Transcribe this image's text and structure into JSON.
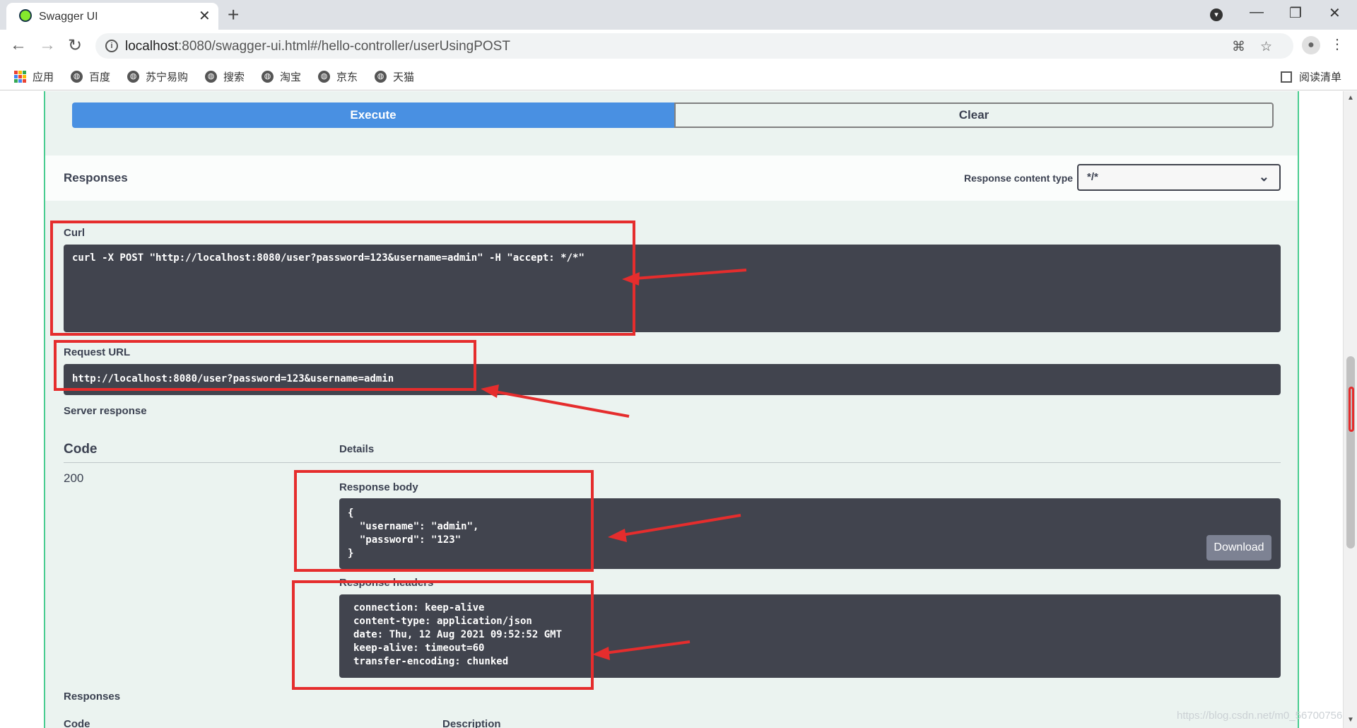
{
  "browser": {
    "tab_title": "Swagger UI",
    "tab_close": "✕",
    "new_tab": "+",
    "url_host": "localhost",
    "url_rest": ":8080/swagger-ui.html#/hello-controller/userUsingPOST",
    "window_controls": {
      "minimize": "—",
      "maximize": "❐",
      "close": "✕"
    }
  },
  "bookmarks": {
    "apps_label": "应用",
    "items": [
      "百度",
      "苏宁易购",
      "搜索",
      "淘宝",
      "京东",
      "天猫"
    ],
    "reading_list": "阅读清单"
  },
  "swagger": {
    "execute_label": "Execute",
    "clear_label": "Clear",
    "responses_title": "Responses",
    "response_content_type_label": "Response content type",
    "response_content_type_value": "*/*",
    "curl_label": "Curl",
    "curl_command": "curl -X POST \"http://localhost:8080/user?password=123&username=admin\" -H \"accept: */*\"",
    "request_url_label": "Request URL",
    "request_url": "http://localhost:8080/user?password=123&username=admin",
    "server_response_label": "Server response",
    "table_code_header": "Code",
    "table_details_header": "Details",
    "status_code": "200",
    "response_body_label": "Response body",
    "response_body": "{\n  \"username\": \"admin\",\n  \"password\": \"123\"\n}",
    "download_label": "Download",
    "response_headers_label": "Response headers",
    "response_headers": "connection: keep-alive\ncontent-type: application/json\ndate: Thu, 12 Aug 2021 09:52:52 GMT\nkeep-alive: timeout=60\ntransfer-encoding: chunked",
    "responses_footer_label": "Responses",
    "footer_code_header": "Code",
    "footer_description_header": "Description"
  },
  "watermark": "https://blog.csdn.net/m0_56700756",
  "colors": {
    "execute_blue": "#4990e2",
    "post_green": "#49cc90",
    "annotation_red": "#e52d2d",
    "code_bg": "#41444e"
  }
}
